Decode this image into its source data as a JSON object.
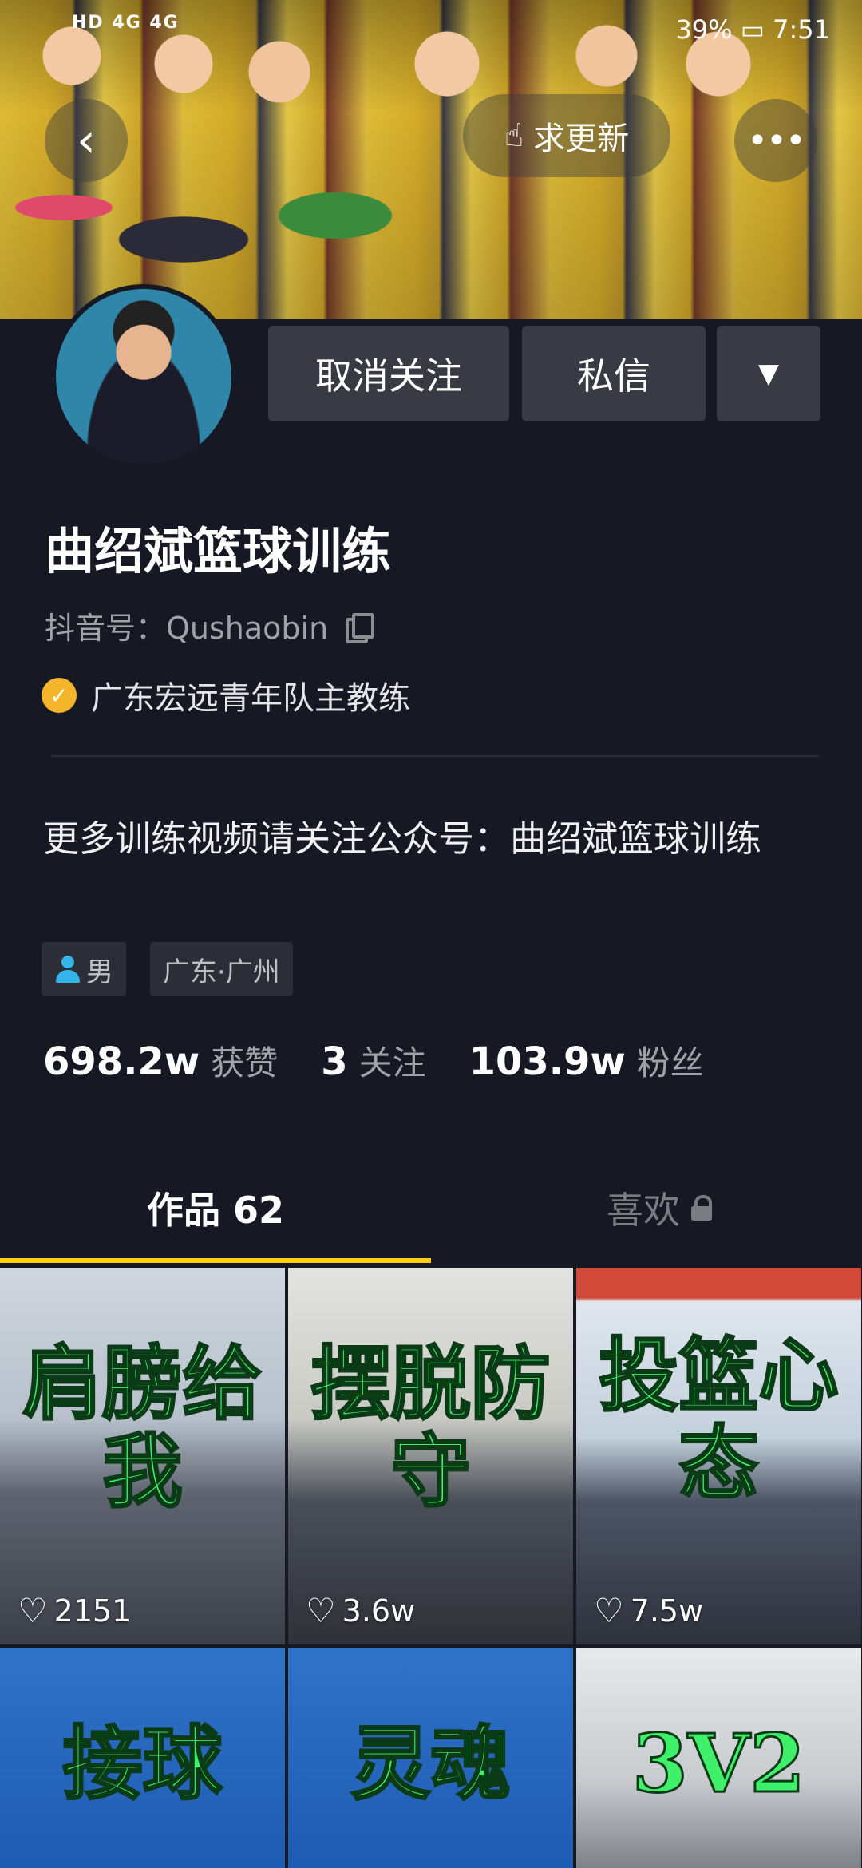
{
  "status_bar": {
    "left": "HD 4G 4G",
    "battery": "39%",
    "time": "7:51"
  },
  "header": {
    "back_icon": "chevron-left-icon",
    "update_label": "求更新",
    "more_icon": "more-icon"
  },
  "profile": {
    "unfollow_label": "取消关注",
    "message_label": "私信",
    "name": "曲绍斌篮球训练",
    "douyin_id": "抖音号：Qushaobin",
    "verified_text": "广东宏远青年队主教练",
    "bio": "更多训练视频请关注公众号：曲绍斌篮球训练",
    "gender": "男",
    "location": "广东·广州"
  },
  "stats": [
    {
      "value": "698.2w",
      "label": "获赞"
    },
    {
      "value": "3",
      "label": "关注"
    },
    {
      "value": "103.9w",
      "label": "粉丝"
    }
  ],
  "tabs": {
    "works": "作品 62",
    "likes": "喜欢"
  },
  "videos": [
    {
      "title": "肩膀给我",
      "likes": "2151"
    },
    {
      "title": "摆脱防守",
      "likes": "3.6w"
    },
    {
      "title": "投篮心态",
      "likes": "7.5w"
    },
    {
      "title": "接球",
      "likes": ""
    },
    {
      "title": "灵魂",
      "likes": ""
    },
    {
      "title": "3V2",
      "likes": ""
    }
  ],
  "colors": {
    "background": "#161823",
    "tab_indicator": "#face15",
    "verified": "#f5b52a",
    "button_bg": "#393b44"
  }
}
